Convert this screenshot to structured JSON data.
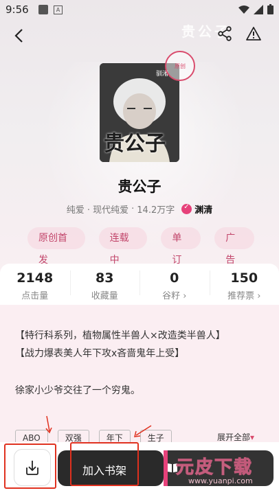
{
  "status_bar": {
    "time": "9:56"
  },
  "hero": {
    "bg_title": "贵公子"
  },
  "cover": {
    "title": "贵公子",
    "badge_text": "驯渚",
    "stamp_text": "原创"
  },
  "book": {
    "title": "贵公子",
    "category": "纯爱 · 现代纯爱",
    "word_count": "14.2万字",
    "author": "渊清"
  },
  "tags": [
    "原创首发",
    "连载中",
    "单订",
    "广告"
  ],
  "stats": [
    {
      "value": "2148",
      "label": "点击量"
    },
    {
      "value": "83",
      "label": "收藏量"
    },
    {
      "value": "0",
      "label": "谷籽 ›"
    },
    {
      "value": "150",
      "label": "推荐票 ›"
    }
  ],
  "description": [
    "【特行科系列，植物属性半兽人×改造类半兽人】",
    "【战力爆表美人年下攻x吝啬鬼年上受】",
    "徐家小少爷交往了一个穷鬼。"
  ],
  "genre_tags": [
    "ABO",
    "双强",
    "年下",
    "生子"
  ],
  "expand_label": "展开全部",
  "bottom": {
    "shelf_label": "加入书架"
  },
  "watermark": {
    "main": "元皮下载",
    "url": "www.yuanpi.com"
  },
  "colors": {
    "accent": "#e6417a",
    "tag_text": "#c2466b",
    "highlight": "#e0301e"
  },
  "icons": {
    "back": "back-arrow-icon",
    "share": "share-icon",
    "report": "warning-icon",
    "download": "download-icon",
    "verified": "verified-icon",
    "read": "book-icon"
  }
}
